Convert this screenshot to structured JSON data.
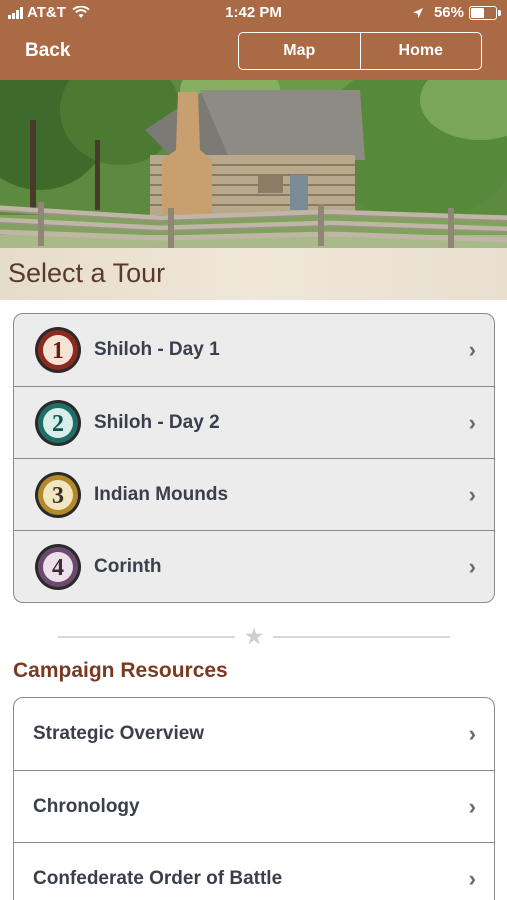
{
  "status_bar": {
    "carrier": "AT&T",
    "time": "1:42 PM",
    "battery_percent": "56%",
    "battery_level": 0.56,
    "icons": [
      "signal-icon",
      "wifi-icon",
      "location-arrow-icon",
      "battery-icon"
    ]
  },
  "nav": {
    "back_label": "Back",
    "map_label": "Map",
    "home_label": "Home"
  },
  "section_title": "Select a Tour",
  "tours": [
    {
      "number": "1",
      "label": "Shiloh - Day 1",
      "color": "#8b2a1d"
    },
    {
      "number": "2",
      "label": "Shiloh - Day 2",
      "color": "#1f6f67"
    },
    {
      "number": "3",
      "label": "Indian Mounds",
      "color": "#b38a2a"
    },
    {
      "number": "4",
      "label": "Corinth",
      "color": "#6b4a6e"
    }
  ],
  "resources_title": "Campaign Resources",
  "resources": [
    {
      "label": "Strategic Overview"
    },
    {
      "label": "Chronology"
    },
    {
      "label": "Confederate Order of Battle"
    }
  ],
  "colors": {
    "header_brown": "#a96a45",
    "resources_title": "#7a3a22"
  }
}
